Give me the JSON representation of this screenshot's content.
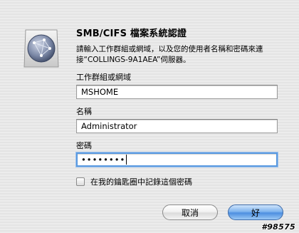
{
  "dialog": {
    "title": "SMB/CIFS 檔案系統認證",
    "description_lines": [
      "請輸入工作群組或網域，以及您的使用者名稱和密碼來連",
      "接“COLLINGS-9A1AEA”伺服器。"
    ],
    "workgroup": {
      "label": "工作群組或網域",
      "value": "MSHOME"
    },
    "name": {
      "label": "名稱",
      "value": "Administrator"
    },
    "password": {
      "label": "密碼",
      "masked_value": "••••••••"
    },
    "remember_checkbox": {
      "label": "在我的鑰匙圈中記錄這個密碼",
      "checked": false
    },
    "buttons": {
      "cancel": "取消",
      "ok": "好"
    },
    "icon": "network-globe-icon"
  },
  "watermark": "#98575",
  "colors": {
    "focus_ring": "#5b9ae0",
    "default_button": "#4d8fe0"
  }
}
